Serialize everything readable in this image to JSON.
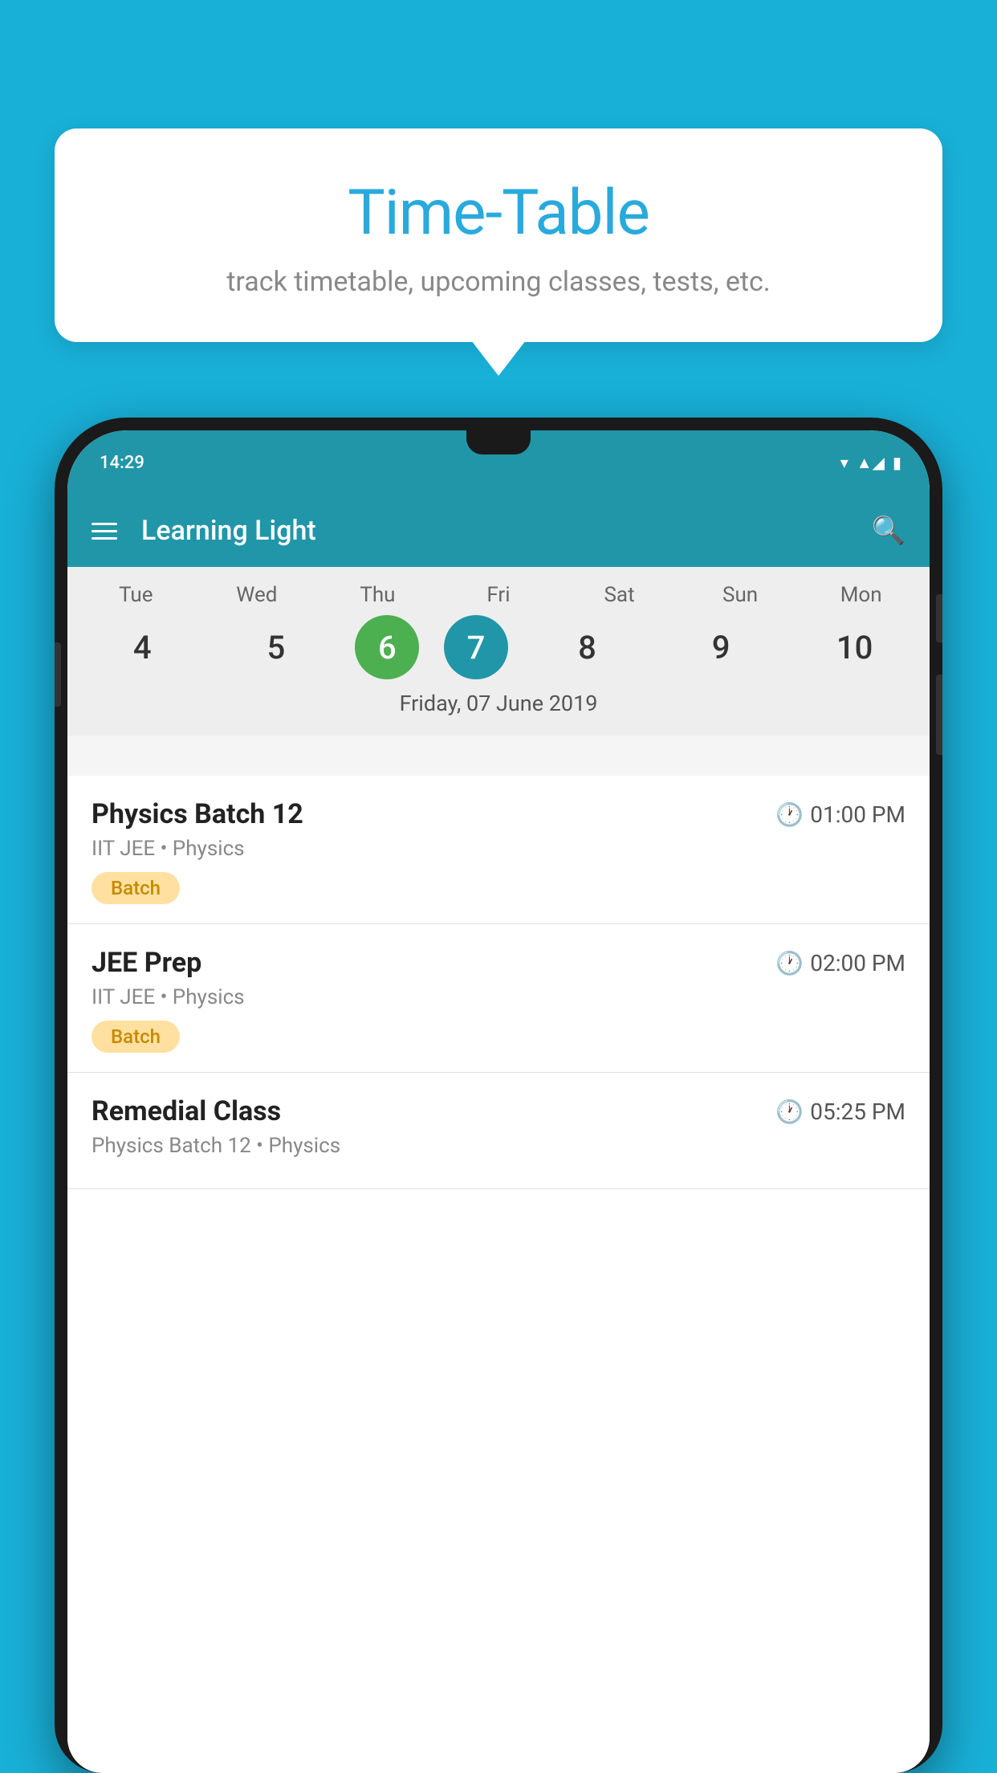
{
  "background": {
    "color": "#19b0d8"
  },
  "tooltip": {
    "title": "Time-Table",
    "subtitle": "track timetable, upcoming classes, tests, etc."
  },
  "phone": {
    "status_bar": {
      "time": "14:29"
    },
    "app_bar": {
      "title": "Learning Light"
    },
    "calendar": {
      "weekdays": [
        "Tue",
        "Wed",
        "Thu",
        "Fri",
        "Sat",
        "Sun",
        "Mon"
      ],
      "dates": [
        "4",
        "5",
        "6",
        "7",
        "8",
        "9",
        "10"
      ],
      "today_index": 2,
      "selected_index": 3,
      "selected_label": "Friday, 07 June 2019"
    },
    "schedule": [
      {
        "title": "Physics Batch 12",
        "time": "01:00 PM",
        "subtitle": "IIT JEE • Physics",
        "badge": "Batch"
      },
      {
        "title": "JEE Prep",
        "time": "02:00 PM",
        "subtitle": "IIT JEE • Physics",
        "badge": "Batch"
      },
      {
        "title": "Remedial Class",
        "time": "05:25 PM",
        "subtitle": "Physics Batch 12 • Physics",
        "badge": null
      }
    ]
  }
}
